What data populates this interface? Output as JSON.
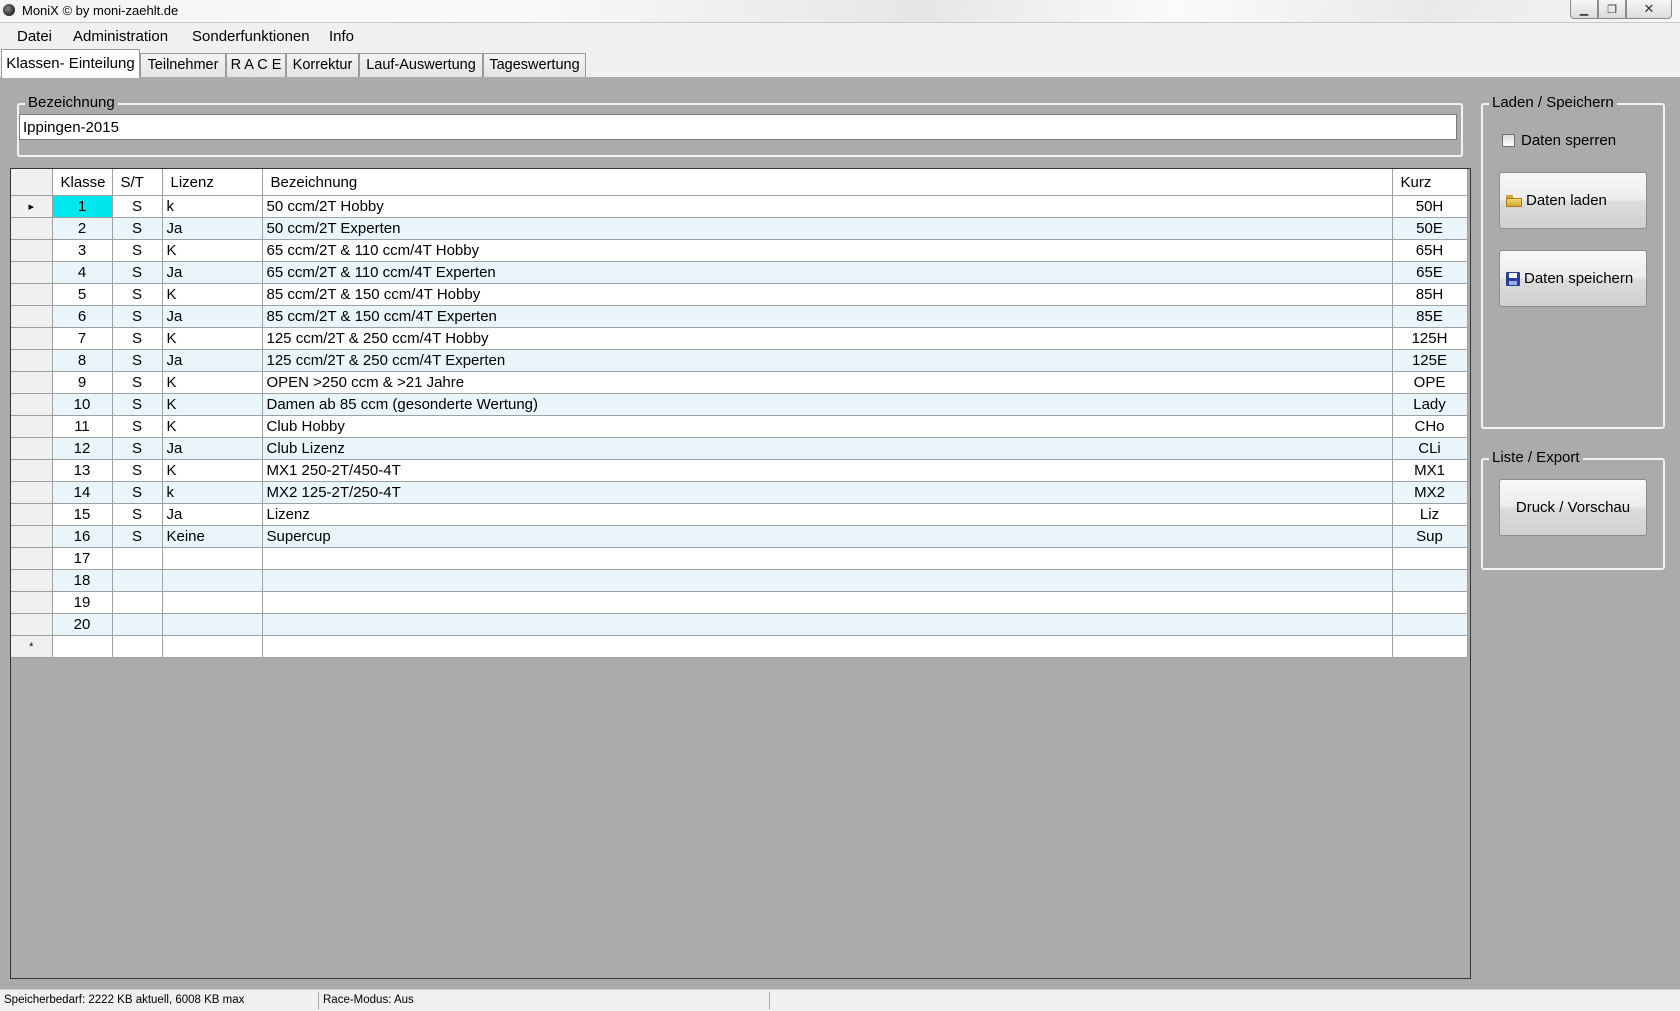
{
  "window": {
    "title": "MoniX © by moni-zaehlt.de"
  },
  "menu": [
    "Datei",
    "Administration",
    "Sonderfunktionen",
    "Info"
  ],
  "tabs": [
    "Klassen- Einteilung",
    "Teilnehmer",
    "R A C E",
    "Korrektur",
    "Lauf-Auswertung",
    "Tageswertung"
  ],
  "bezeichnung": {
    "label": "Bezeichnung",
    "value": "Ippingen-2015"
  },
  "grid": {
    "columns": [
      "Klasse",
      "S/T",
      "Lizenz",
      "Bezeichnung",
      "Kurz"
    ],
    "rows": [
      [
        "1",
        "S",
        "k",
        "50 ccm/2T Hobby",
        "50H"
      ],
      [
        "2",
        "S",
        "Ja",
        "50 ccm/2T Experten",
        "50E"
      ],
      [
        "3",
        "S",
        "K",
        "65 ccm/2T & 110 ccm/4T Hobby",
        "65H"
      ],
      [
        "4",
        "S",
        "Ja",
        "65 ccm/2T & 110 ccm/4T Experten",
        "65E"
      ],
      [
        "5",
        "S",
        "K",
        "85 ccm/2T & 150 ccm/4T Hobby",
        "85H"
      ],
      [
        "6",
        "S",
        "Ja",
        "85 ccm/2T & 150 ccm/4T Experten",
        "85E"
      ],
      [
        "7",
        "S",
        "K",
        "125 ccm/2T & 250 ccm/4T Hobby",
        "125H"
      ],
      [
        "8",
        "S",
        "Ja",
        "125 ccm/2T & 250 ccm/4T Experten",
        "125E"
      ],
      [
        "9",
        "S",
        "K",
        "OPEN >250 ccm & >21 Jahre",
        "OPE"
      ],
      [
        "10",
        "S",
        "K",
        "Damen ab 85 ccm (gesonderte Wertung)",
        "Lady"
      ],
      [
        "11",
        "S",
        "K",
        "Club Hobby",
        "CHo"
      ],
      [
        "12",
        "S",
        "Ja",
        "Club Lizenz",
        "CLi"
      ],
      [
        "13",
        "S",
        "K",
        "MX1 250-2T/450-4T",
        "MX1"
      ],
      [
        "14",
        "S",
        "k",
        "MX2 125-2T/250-4T",
        "MX2"
      ],
      [
        "15",
        "S",
        "Ja",
        "Lizenz",
        "Liz"
      ],
      [
        "16",
        "S",
        "Keine",
        "Supercup",
        "Sup"
      ],
      [
        "17",
        "",
        "",
        "",
        ""
      ],
      [
        "18",
        "",
        "",
        "",
        ""
      ],
      [
        "19",
        "",
        "",
        "",
        ""
      ],
      [
        "20",
        "",
        "",
        "",
        ""
      ]
    ],
    "current_row_marker": "▸",
    "new_row_marker": "*"
  },
  "laden_speichern": {
    "label": "Laden / Speichern",
    "lock_label": "Daten sperren",
    "load_label": "Daten laden",
    "save_label": "Daten speichern"
  },
  "liste_export": {
    "label": "Liste / Export",
    "print_label": "Druck / Vorschau"
  },
  "status": {
    "memory": "Speicherbedarf: 2222 KB aktuell, 6008 KB max",
    "race_mode": "Race-Modus: Aus"
  },
  "colors": {
    "selected_cell": "#00e6ef",
    "alt_row": "#e9f4fb",
    "background": "#ababab"
  }
}
